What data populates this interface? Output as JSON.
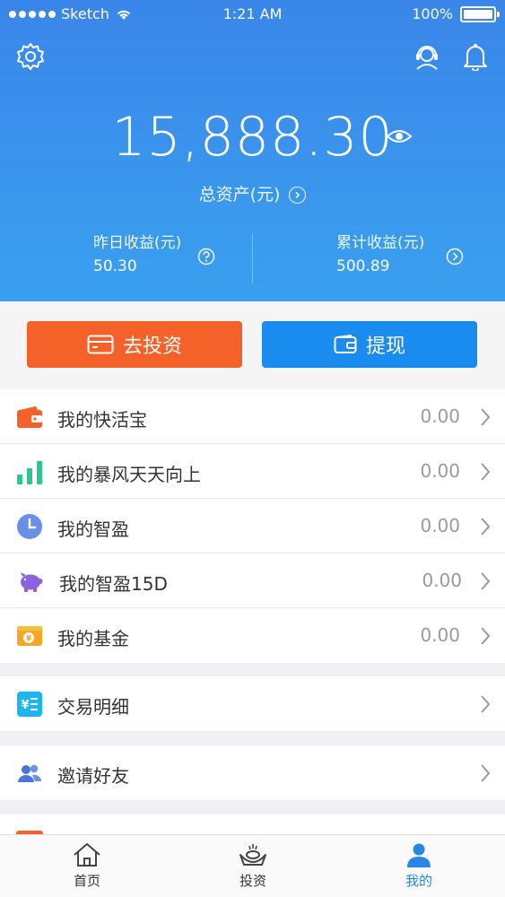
{
  "status_bar": {
    "carrier": "Sketch",
    "time": "1:21 AM",
    "battery": "100%"
  },
  "header": {
    "total_amount": "15,888.30",
    "total_label": "总资产(元)",
    "yesterday_label": "昨日收益(元)",
    "yesterday_value": "50.30",
    "cumulative_label": "累计收益(元)",
    "cumulative_value": "500.89"
  },
  "actions": {
    "invest_label": "去投资",
    "withdraw_label": "提现"
  },
  "products": [
    {
      "label": "我的快活宝",
      "value": "0.00",
      "icon": "wallet-icon",
      "color": "#f4622a"
    },
    {
      "label": "我的暴风天天向上",
      "value": "0.00",
      "icon": "bar-chart-icon",
      "color": "#2ec68f"
    },
    {
      "label": "我的智盈",
      "value": "0.00",
      "icon": "clock-icon",
      "color": "#6b8fe8"
    },
    {
      "label": "我的智盈15D",
      "value": "0.00",
      "icon": "piggy-bank-icon",
      "color": "#8b62e0"
    },
    {
      "label": "我的基金",
      "value": "0.00",
      "icon": "fund-icon",
      "color": "#f5a623"
    }
  ],
  "menu": {
    "transactions_label": "交易明细",
    "invite_label": "邀请好友"
  },
  "tabs": {
    "home_label": "首页",
    "invest_label": "投资",
    "mine_label": "我的"
  },
  "colors": {
    "header_gradient_top": "#3a86ea",
    "header_gradient_bottom": "#3aa0ee",
    "invest_button": "#f4622a",
    "withdraw_button": "#1a8cf0",
    "active_tab": "#2a86e6"
  }
}
